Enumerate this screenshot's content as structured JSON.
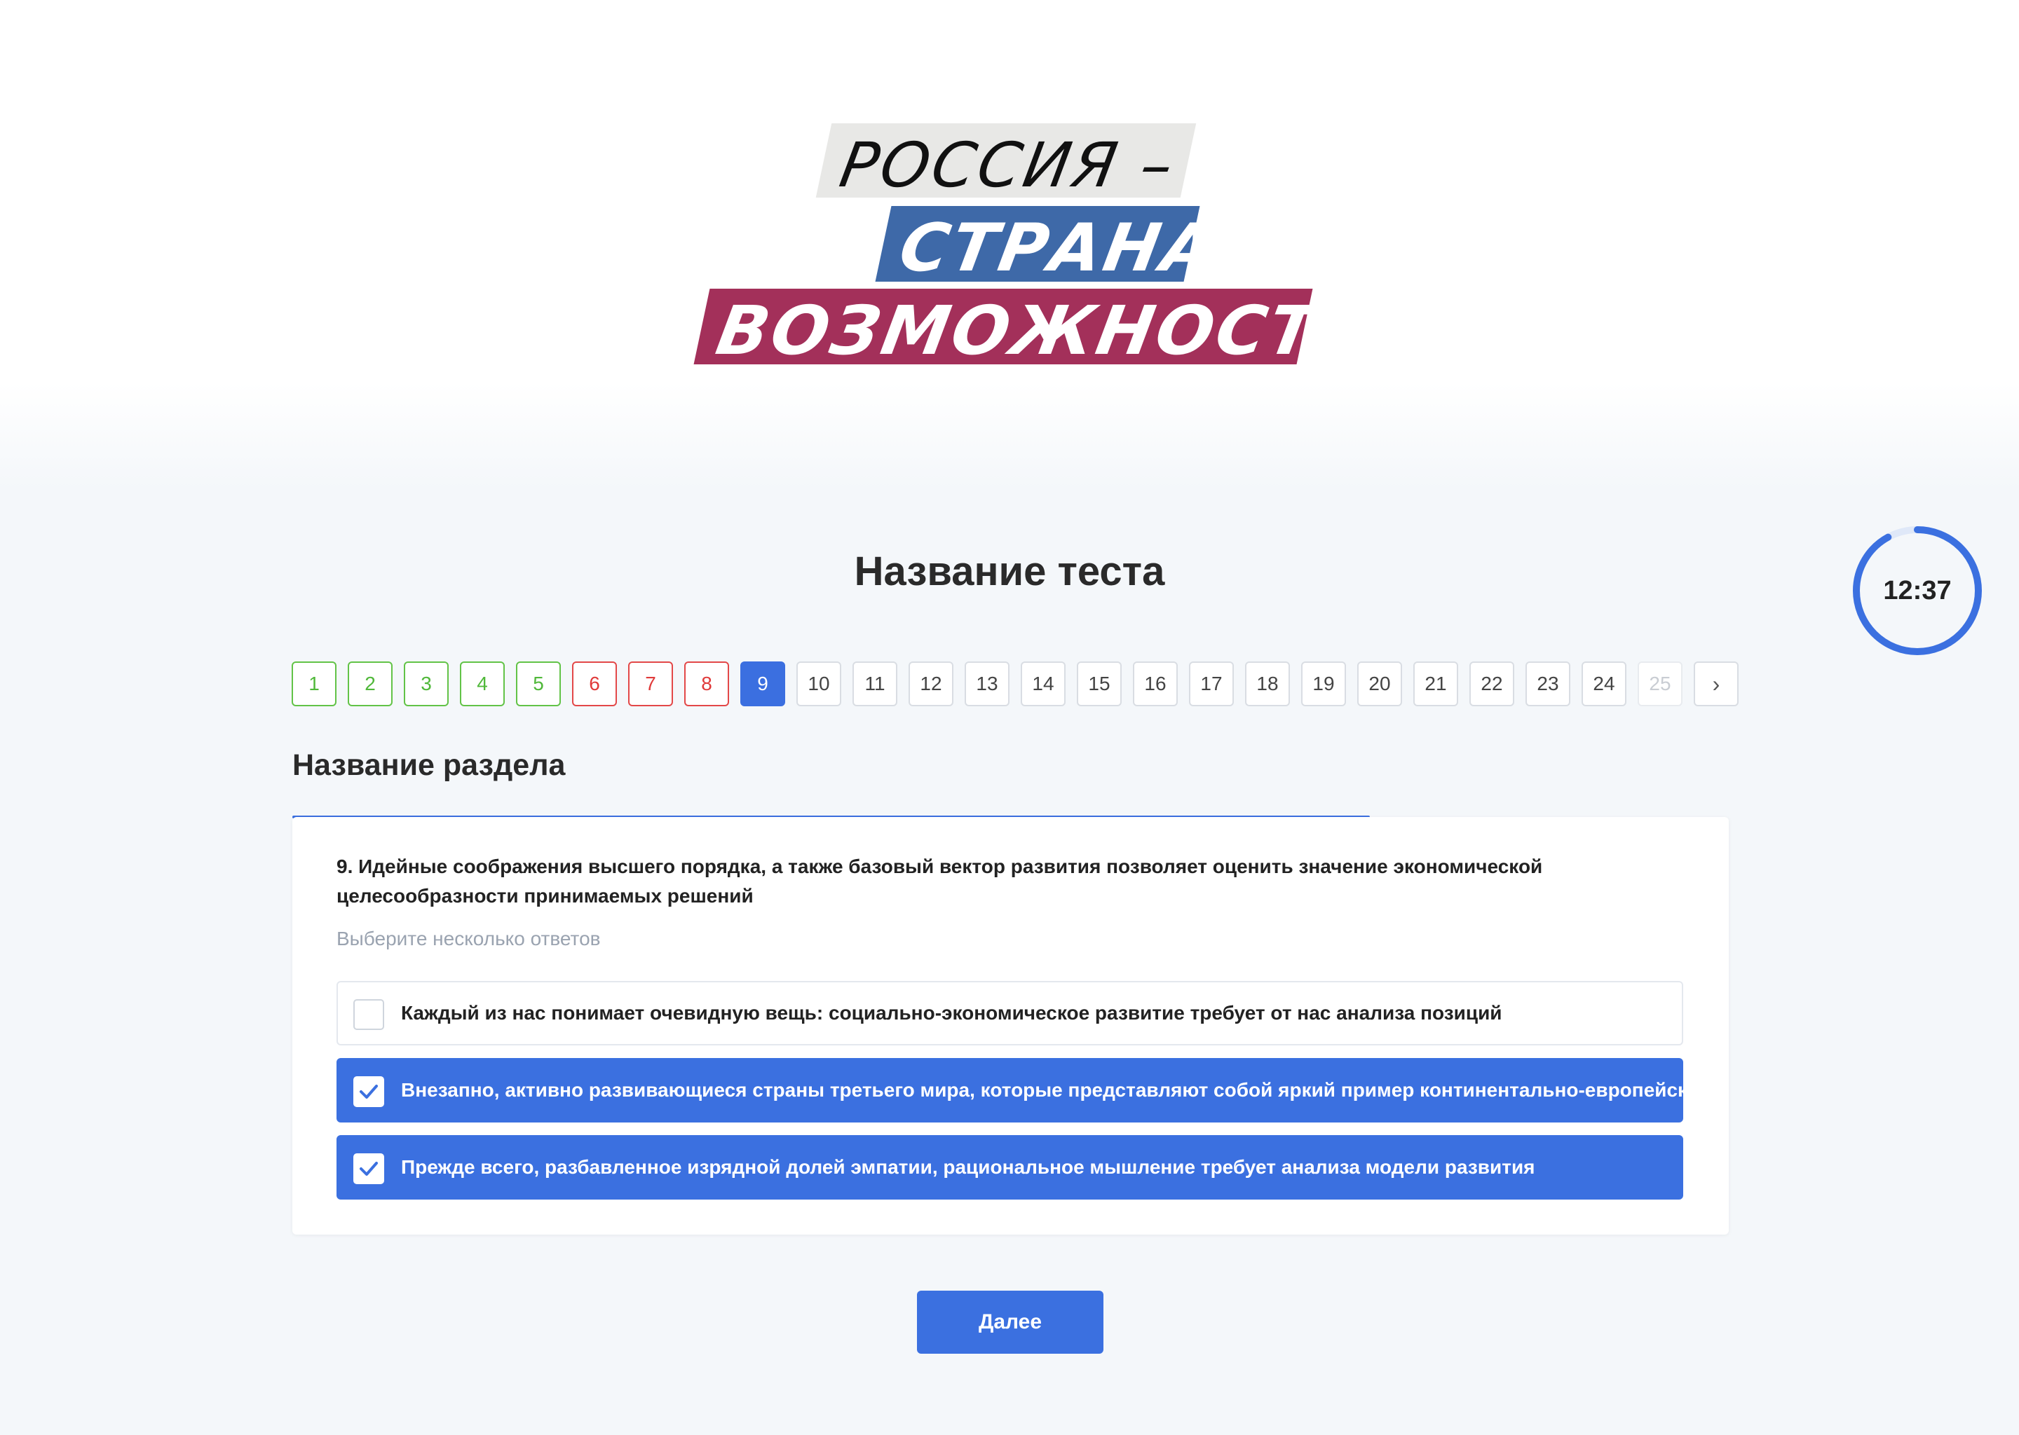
{
  "logo": {
    "line1": "РОССИЯ –",
    "line2": "СТРАНА",
    "line3": "ВОЗМОЖНОСТЕЙ",
    "colors": {
      "band1": "#e8e8e6",
      "band2": "#3e69a8",
      "band3": "#a3305a"
    }
  },
  "test": {
    "title": "Название теста"
  },
  "timer": {
    "value": "12:37",
    "remaining_fraction": 0.92
  },
  "pagination": {
    "pages": [
      {
        "label": "1",
        "state": "done"
      },
      {
        "label": "2",
        "state": "done"
      },
      {
        "label": "3",
        "state": "done"
      },
      {
        "label": "4",
        "state": "done"
      },
      {
        "label": "5",
        "state": "done"
      },
      {
        "label": "6",
        "state": "wrong"
      },
      {
        "label": "7",
        "state": "wrong"
      },
      {
        "label": "8",
        "state": "wrong"
      },
      {
        "label": "9",
        "state": "current"
      },
      {
        "label": "10",
        "state": "default"
      },
      {
        "label": "11",
        "state": "default"
      },
      {
        "label": "12",
        "state": "default"
      },
      {
        "label": "13",
        "state": "default"
      },
      {
        "label": "14",
        "state": "default"
      },
      {
        "label": "15",
        "state": "default"
      },
      {
        "label": "16",
        "state": "default"
      },
      {
        "label": "17",
        "state": "default"
      },
      {
        "label": "18",
        "state": "default"
      },
      {
        "label": "19",
        "state": "default"
      },
      {
        "label": "20",
        "state": "default"
      },
      {
        "label": "21",
        "state": "default"
      },
      {
        "label": "22",
        "state": "default"
      },
      {
        "label": "23",
        "state": "default"
      },
      {
        "label": "24",
        "state": "default"
      },
      {
        "label": "25",
        "state": "faded"
      }
    ],
    "next_icon": "chevron-right-icon",
    "next_glyph": "›"
  },
  "section": {
    "title": "Название раздела",
    "progress_fraction": 0.75
  },
  "question": {
    "text": "9. Идейные соображения высшего порядка, а также базовый вектор развития позволяет оценить значение экономической целесообразности принимаемых решений",
    "hint": "Выберите несколько ответов",
    "options": [
      {
        "text": "Каждый из нас понимает очевидную вещь: социально-экономическое развитие требует от нас анализа позиций",
        "checked": false
      },
      {
        "text": "Внезапно, активно развивающиеся страны третьего мира, которые представляют собой яркий пример континентально-европейского",
        "checked": true
      },
      {
        "text": "Прежде всего, разбавленное изрядной долей эмпатии, рациональное мышление требует анализа модели развития",
        "checked": true
      }
    ]
  },
  "actions": {
    "next_label": "Далее"
  },
  "colors": {
    "accent": "#3b70e0",
    "done": "#50b83a",
    "wrong": "#e03a3a",
    "background": "#f4f7fa"
  }
}
